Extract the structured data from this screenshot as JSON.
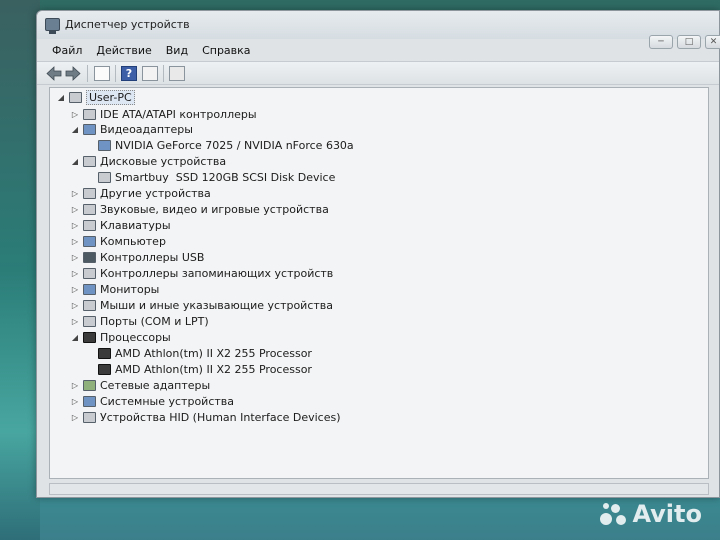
{
  "window": {
    "title": "Диспетчер устройств",
    "controls": [
      "─",
      "□",
      "✕"
    ]
  },
  "menubar": {
    "items": [
      "Файл",
      "Действие",
      "Вид",
      "Справка"
    ]
  },
  "toolbar": {
    "icons": [
      "back-arrow-icon",
      "forward-arrow-icon",
      "properties-icon",
      "help-icon",
      "view-icon",
      "scan-hardware-icon"
    ],
    "help_glyph": "?"
  },
  "tree": {
    "root": "User-PC",
    "nodes": [
      {
        "label": "IDE ATA/ATAPI контроллеры",
        "expanded": false,
        "icon": "ide-controller-icon"
      },
      {
        "label": "Видеоадаптеры",
        "expanded": true,
        "icon": "display-adapter-icon",
        "children": [
          "NVIDIA GeForce 7025 / NVIDIA nForce 630a"
        ]
      },
      {
        "label": "Дисковые устройства",
        "expanded": true,
        "icon": "disk-drive-icon",
        "children": [
          "Smartbuy  SSD 120GB SCSI Disk Device"
        ]
      },
      {
        "label": "Другие устройства",
        "expanded": false,
        "icon": "other-devices-icon"
      },
      {
        "label": "Звуковые, видео и игровые устройства",
        "expanded": false,
        "icon": "sound-icon"
      },
      {
        "label": "Клавиатуры",
        "expanded": false,
        "icon": "keyboard-icon"
      },
      {
        "label": "Компьютер",
        "expanded": false,
        "icon": "computer-icon"
      },
      {
        "label": "Контроллеры USB",
        "expanded": false,
        "icon": "usb-icon"
      },
      {
        "label": "Контроллеры запоминающих устройств",
        "expanded": false,
        "icon": "storage-controller-icon"
      },
      {
        "label": "Мониторы",
        "expanded": false,
        "icon": "monitor-icon"
      },
      {
        "label": "Мыши и иные указывающие устройства",
        "expanded": false,
        "icon": "mouse-icon"
      },
      {
        "label": "Порты (COM и LPT)",
        "expanded": false,
        "icon": "port-icon"
      },
      {
        "label": "Процессоры",
        "expanded": true,
        "icon": "processor-icon",
        "children": [
          "AMD Athlon(tm) II X2 255 Processor",
          "AMD Athlon(tm) II X2 255 Processor"
        ]
      },
      {
        "label": "Сетевые адаптеры",
        "expanded": false,
        "icon": "network-adapter-icon"
      },
      {
        "label": "Системные устройства",
        "expanded": false,
        "icon": "system-devices-icon"
      },
      {
        "label": "Устройства HID (Human Interface Devices)",
        "expanded": false,
        "icon": "hid-icon"
      }
    ]
  },
  "watermark": "Avito"
}
